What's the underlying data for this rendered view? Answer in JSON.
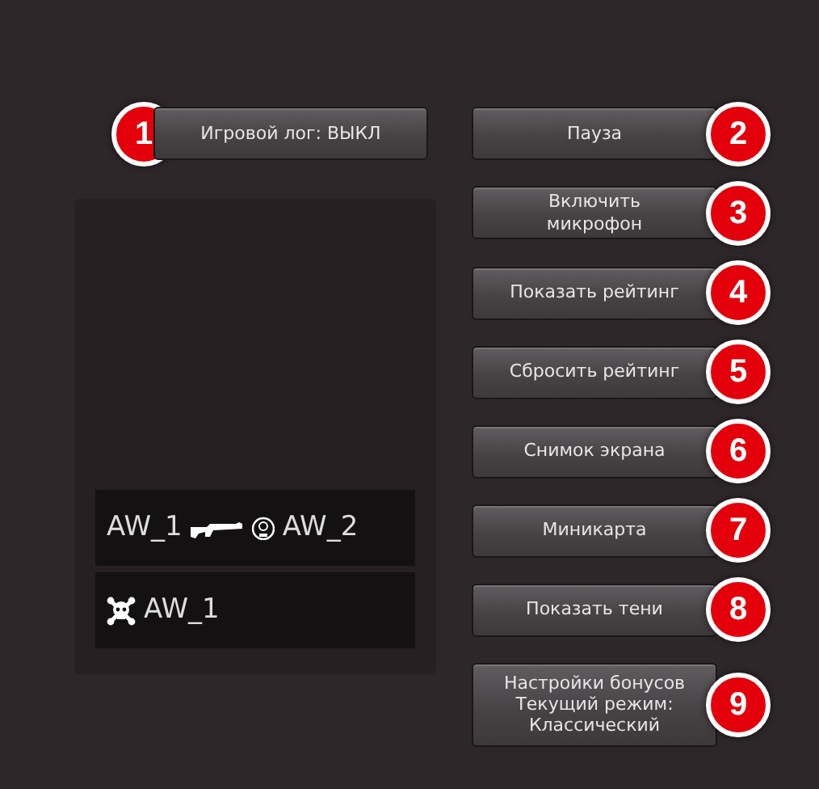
{
  "log_button": {
    "label": "Игровой лог: ВЫКЛ",
    "badge": "1"
  },
  "kill_feed": [
    {
      "kind": "kill",
      "killer": "AW_1",
      "victim": "AW_2"
    },
    {
      "kind": "death",
      "victim": "AW_1"
    }
  ],
  "menu_buttons": [
    {
      "label": "Пауза",
      "badge": "2"
    },
    {
      "label": "Включить микрофон",
      "badge": "3"
    },
    {
      "label": "Показать рейтинг",
      "badge": "4"
    },
    {
      "label": "Сбросить рейтинг",
      "badge": "5"
    },
    {
      "label": "Снимок экрана",
      "badge": "6"
    },
    {
      "label": "Миникарта",
      "badge": "7"
    },
    {
      "label": "Показать тени",
      "badge": "8"
    },
    {
      "label": "Настройки бонусов Текущий режим: Классический",
      "badge": "9"
    }
  ]
}
